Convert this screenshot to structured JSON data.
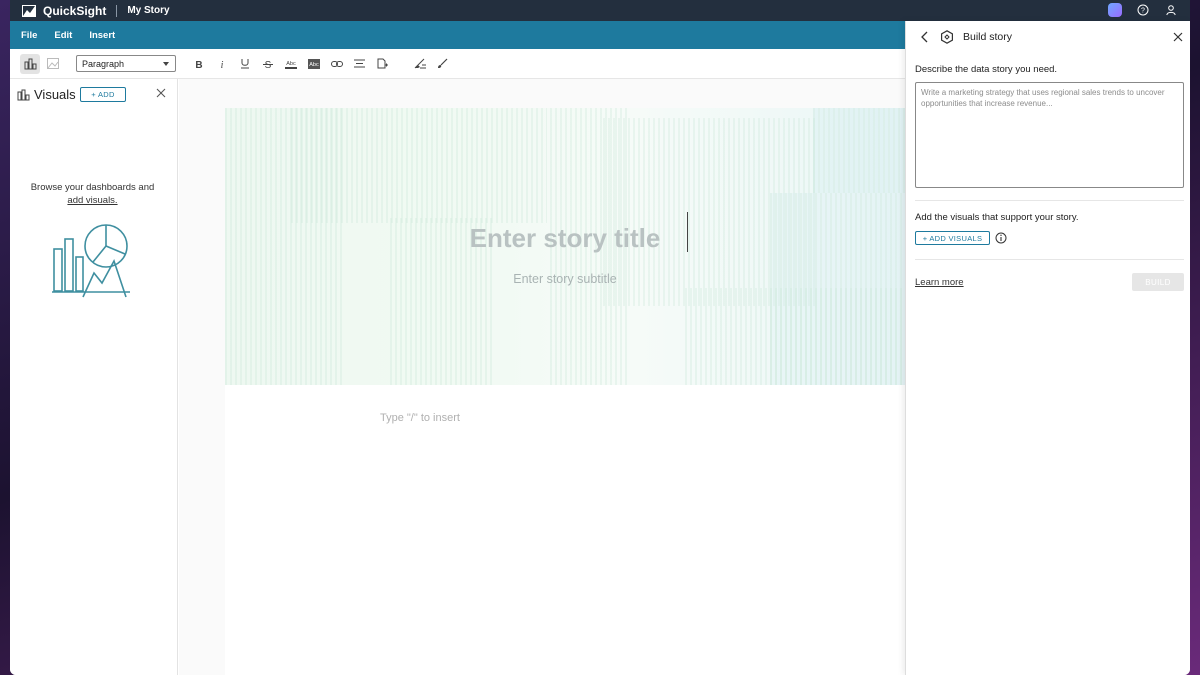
{
  "topbar": {
    "app_name": "QuickSight",
    "doc_name": "My Story"
  },
  "menubar": {
    "items": [
      {
        "label": "File"
      },
      {
        "label": "Edit"
      },
      {
        "label": "Insert"
      }
    ]
  },
  "toolbar": {
    "style_select": {
      "value": "Paragraph"
    }
  },
  "left_panel": {
    "title": "Visuals",
    "add_label": "+ ADD",
    "message": "Browse your dashboards and",
    "link_text": "add visuals."
  },
  "canvas": {
    "title_placeholder": "Enter story title",
    "subtitle_placeholder": "Enter story subtitle",
    "insert_hint": "Type \"/\" to insert"
  },
  "right_panel": {
    "title": "Build story",
    "prompt_label": "Describe the data story you need.",
    "prompt_placeholder": "Write a marketing strategy that uses regional sales trends to uncover opportunities that increase revenue...",
    "visuals_label": "Add the visuals that support your story.",
    "add_visuals_label": "+ ADD VISUALS",
    "learn_more": "Learn more",
    "build_label": "BUILD"
  },
  "colors": {
    "topbar": "#232f3e",
    "menubar": "#1e7a9e",
    "accent": "#1e7a9e",
    "illustration": "#3f8fa0"
  }
}
